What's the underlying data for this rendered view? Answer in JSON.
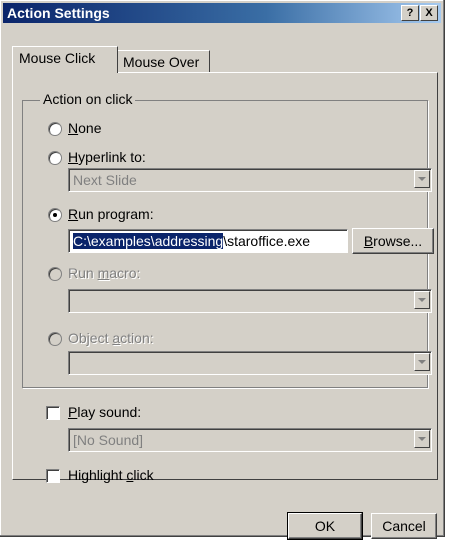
{
  "window": {
    "title": "Action Settings",
    "help_glyph": "?",
    "close_glyph": "X"
  },
  "tabs": [
    {
      "label": "Mouse Click",
      "active": true
    },
    {
      "label": "Mouse Over",
      "active": false
    }
  ],
  "group": {
    "legend": "Action on click",
    "options": {
      "none": {
        "pre": "",
        "key": "N",
        "post": "one",
        "selected": false
      },
      "hyperlink": {
        "pre": "",
        "key": "H",
        "post": "yperlink to:",
        "selected": false
      },
      "run_program": {
        "pre": "",
        "key": "R",
        "post": "un program:",
        "selected": true
      },
      "run_macro": {
        "pre": "Run ",
        "key": "m",
        "post": "acro:",
        "selected": false,
        "disabled": true
      },
      "object_action": {
        "pre": "Object ",
        "key": "a",
        "post": "ction:",
        "selected": false,
        "disabled": true
      }
    },
    "hyperlink_value": "Next Slide",
    "program_path_selected": "C:\\examples\\addressing",
    "program_path_rest": "\\staroffice.exe",
    "browse_button": {
      "pre": "",
      "key": "B",
      "post": "rowse..."
    }
  },
  "sound": {
    "checkbox": {
      "pre": "",
      "key": "P",
      "post": "lay sound:",
      "checked": false
    },
    "value": "[No Sound]"
  },
  "highlight": {
    "pre": "Highlight ",
    "key": "c",
    "post": "lick",
    "checked": false
  },
  "footer": {
    "ok": "OK",
    "cancel": "Cancel"
  }
}
